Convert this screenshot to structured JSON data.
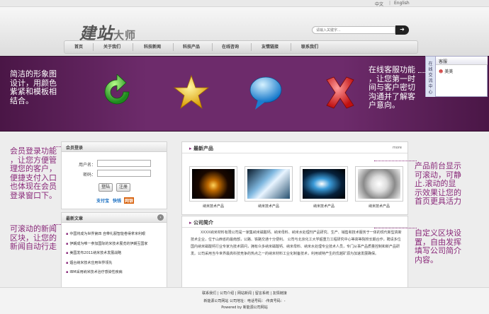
{
  "topbar": {
    "lang_cn": "中文",
    "sep": "|",
    "lang_en": "English"
  },
  "header": {
    "logo_main": "建站",
    "logo_small": "大师",
    "search_placeholder": "请输入关键字...",
    "search_icon": "arrow-right-icon"
  },
  "nav": {
    "items": [
      "首页",
      "关于我们",
      "科技新闻",
      "科技产品",
      "在线咨询",
      "友情链接",
      "联系我们"
    ]
  },
  "banner": {
    "icons": [
      "green-refresh-icon",
      "gold-star-icon",
      "blue-speech-bubble-icon",
      "red-x-icon"
    ]
  },
  "notes": {
    "banner_left": [
      "简洁的形象图",
      "设计，用颜色",
      "紫紧和模板相",
      "结合。"
    ],
    "chat_note": [
      "在线客服功能",
      "，让您第一时",
      "间与客户密切",
      "沟通并了解客",
      "户意向。"
    ],
    "login_note": [
      "会员登录功能",
      "，让您方便管",
      "理您的客户，",
      "便捷支付入口",
      "也体现在会员",
      "登录窗口下。"
    ],
    "news_note": [
      "可滚动的新闻",
      "区块，让您的",
      "新闻自动行走"
    ],
    "products_note": [
      "产品前台显示",
      "可滚动，可静",
      "止.滚动的显",
      "示效果让您的",
      "首页更具活力"
    ],
    "company_note": [
      "自定义区块设",
      "置，自由发挥",
      "填写公司简介",
      "内容。"
    ]
  },
  "chat": {
    "tab_label": [
      "在",
      "线",
      "交",
      "流",
      "中",
      "心"
    ],
    "title": "客服",
    "user": "美美",
    "user_icon": "person-icon"
  },
  "login": {
    "title": "会员登录",
    "username_label": "用户名：",
    "password_label": "密码：",
    "login_btn": "登陆",
    "register_btn": "注册",
    "pay1": "支付宝",
    "pay2": "快钱",
    "pay3": "网银"
  },
  "news": {
    "title": "最新文章",
    "more_icon": "circle-arrow-icon",
    "items": [
      "中国将成为世界第四 自带礼服智能卷得拿米利眼",
      "伊朗成为唯一参加国际的米技术展览的伊朗互国家",
      "美国发布2011纳米技术发展战略",
      "烟台纳米技术应用世界领先",
      "IBM采用纳米技术治疗感染性疾病"
    ]
  },
  "products": {
    "title": "最新产品",
    "more": "more",
    "items": [
      {
        "caption": "纳米技术产品"
      },
      {
        "caption": "纳米技术产品"
      },
      {
        "caption": "纳米技术产品"
      },
      {
        "caption": "纳米技术产品"
      }
    ]
  },
  "company": {
    "title": "公司简介",
    "text": "XXXX纳米材料有限公司是一家集纳米磁酸钙、纳米母料、纳米水处理剂产品研究、生产、销售和技术服务于一体的现代新型高新技术企业，位于山西省的最南部，公路、铁路交通十分便利。 公司与北京化工大学超重力工程研究中心等高等院校长期合作，聘请多位国内纳米磁酸钙行业专家为技术顾问，拥有众多纳米磁酸钙、纳米母料、纳米水处理专业技术人员，专门从事产品质量控制和新产品研发。公司采用当今世界最高科技竞争的热点之一的纳米材料工业化制备技术，利用城特产生的优越矿源为加速发展确保。"
  },
  "footer": {
    "links": [
      "联系我们",
      "公司介绍",
      "网站新闻",
      "留言系统",
      "友情链接"
    ],
    "sep": "|",
    "line1": "新能源公司网站 公司地址：电话号码：-传真号码：-",
    "line2": "Powered by 新能源公司网站"
  }
}
